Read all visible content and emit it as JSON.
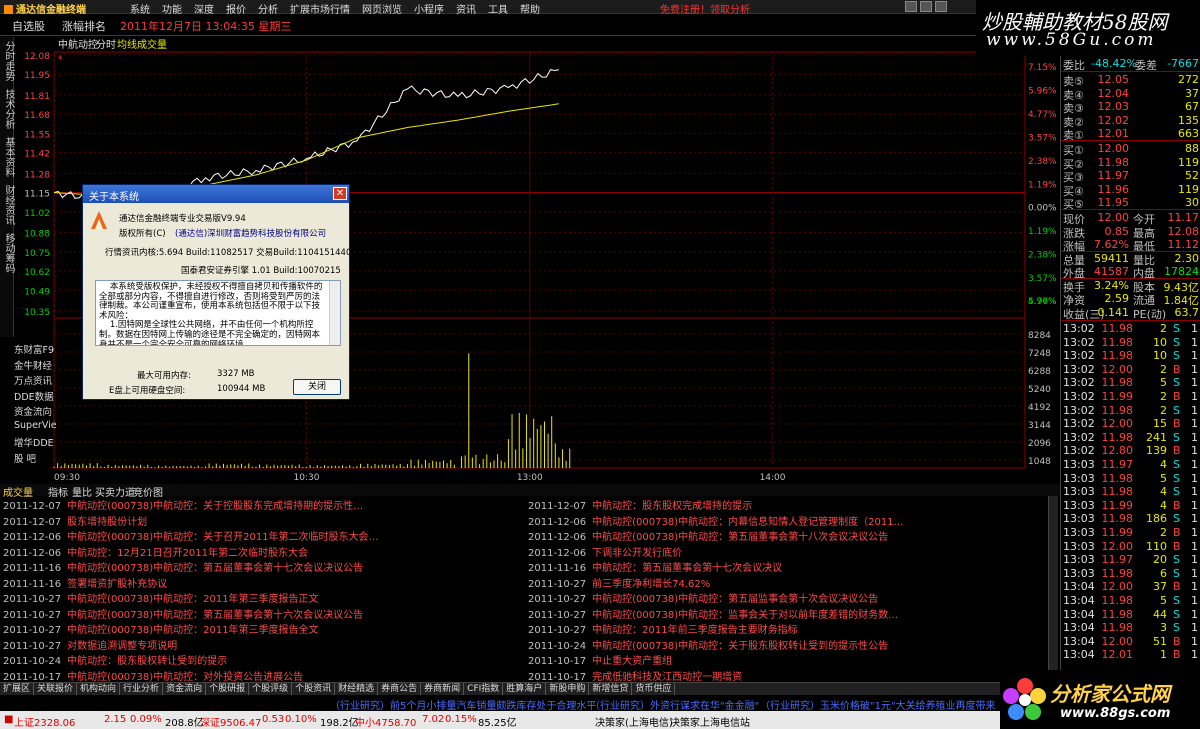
{
  "menubar": {
    "app_title": "通达信金融终端",
    "items": [
      "系统",
      "功能",
      "深度",
      "报价",
      "分析",
      "扩展市场行情",
      "网页浏览",
      "小程序",
      "资讯",
      "工具",
      "帮助"
    ],
    "alert": "免费注册！领取分析"
  },
  "watermark": {
    "line1": "炒股輔助教材58股网",
    "line2": "www.58Gu.com"
  },
  "tabs": {
    "t1": "自选股",
    "t2": "涨幅排名",
    "datetime": "2011年12月7日  13:04:35 星期三"
  },
  "leftstrip": [
    "分时走势",
    "技术分析",
    "基本资料",
    "财经资讯",
    "移动筹码"
  ],
  "chart": {
    "stock": "中航动控",
    "mode": "分时",
    "ma_label": "均线",
    "vol_label": "成交量",
    "price_ticks": [
      "12.08",
      "11.95",
      "11.81",
      "11.68",
      "11.55",
      "11.42",
      "11.28",
      "11.15",
      "11.02",
      "10.88",
      "10.75",
      "10.62",
      "10.49",
      "10.35"
    ],
    "pct_ticks": [
      "7.15%",
      "5.96%",
      "4.77%",
      "3.57%",
      "2.38%",
      "1.19%",
      "0.00%",
      "1.19%",
      "2.38%",
      "3.57%",
      "4.77%",
      "5.96%"
    ],
    "vol_ticks": [
      "8284",
      "7248",
      "6288",
      "5240",
      "4192",
      "3144",
      "2096",
      "1048"
    ],
    "time_ticks": [
      "09:30",
      "10:30",
      "13:00",
      "14:00"
    ]
  },
  "chart_data": {
    "type": "line",
    "x": [
      "09:30",
      "09:45",
      "10:00",
      "10:15",
      "10:30",
      "10:45",
      "11:00",
      "11:15",
      "11:30",
      "13:00",
      "13:04"
    ],
    "series": [
      {
        "name": "中航动控",
        "values": [
          11.15,
          11.1,
          11.12,
          11.25,
          11.3,
          11.38,
          11.5,
          11.85,
          11.8,
          11.86,
          11.98
        ]
      },
      {
        "name": "均线",
        "values": [
          11.15,
          11.13,
          11.15,
          11.2,
          11.27,
          11.37,
          11.52,
          11.59,
          11.64,
          11.7,
          11.75
        ]
      }
    ],
    "volumes": [
      300,
      200,
      150,
      280,
      220,
      180,
      260,
      520,
      7100,
      3400,
      1200
    ],
    "ylim": [
      10.35,
      12.08
    ]
  },
  "sidemenu": [
    "东财富F9",
    "金牛财经",
    "万点资讯",
    "DDE数据",
    "资金流向",
    "SuperVie",
    "增华DDE",
    "股  吧"
  ],
  "bottabs": [
    "成交量",
    "指标",
    "量比",
    "买卖力道",
    "竞价图"
  ],
  "news_left": [
    {
      "d": "2011-12-07",
      "t": "中航动控(000738)中航动控：关于控股股东完成增持期的提示性…"
    },
    {
      "d": "2011-12-07",
      "t": "股东增持股份计划"
    },
    {
      "d": "2011-12-06",
      "t": "中航动控(000738)中航动控：关于召开2011年第二次临时股东大会…"
    },
    {
      "d": "2011-12-06",
      "t": "中航动控：12月21日召开2011年第二次临时股东大会"
    },
    {
      "d": "2011-11-16",
      "t": "中航动控(000738)中航动控：第五届董事会第十七次会议决议公告"
    },
    {
      "d": "2011-11-16",
      "t": "签署增资扩股补充协议"
    },
    {
      "d": "2011-10-27",
      "t": "中航动控(000738)中航动控：2011年第三季度报告正文"
    },
    {
      "d": "2011-10-27",
      "t": "中航动控(000738)中航动控：第五届董事会第十六次会议决议公告"
    },
    {
      "d": "2011-10-27",
      "t": "中航动控(000738)中航动控：2011年第三季度报告全文"
    },
    {
      "d": "2011-10-27",
      "t": "对数据追溯调整专项说明"
    },
    {
      "d": "2011-10-24",
      "t": "中航动控：股东股权转让受到的提示"
    },
    {
      "d": "2011-10-17",
      "t": "中航动控(000738)中航动控：对外投资公告进展公告"
    }
  ],
  "news_right": [
    {
      "d": "2011-12-07",
      "t": "中航动控：股东股权完成增持的提示"
    },
    {
      "d": "2011-12-06",
      "t": "中航动控(000738)中航动控：内幕信息知情人登记管理制度（2011…"
    },
    {
      "d": "2011-12-06",
      "t": "中航动控(000738)中航动控：第五届董事会第十八次会议决议公告"
    },
    {
      "d": "2011-12-06",
      "t": "下调非公开发行底价"
    },
    {
      "d": "2011-11-16",
      "t": "中航动控：第五届董事会第十七次会议决议"
    },
    {
      "d": "2011-10-27",
      "t": "前三季度净利增长74.62%"
    },
    {
      "d": "2011-10-27",
      "t": "中航动控(000738)中航动控：第五届监事会第十次会议决议公告"
    },
    {
      "d": "2011-10-27",
      "t": "中航动控(000738)中航动控：监事会关于对以前年度差错的财务数…"
    },
    {
      "d": "2011-10-27",
      "t": "中航动控：2011年前三季度报告主要财务指标"
    },
    {
      "d": "2011-10-24",
      "t": "中航动控(000738)中航动控：关于股东股权转让受到的提示性公告"
    },
    {
      "d": "2011-10-17",
      "t": "中止重大资产重组"
    },
    {
      "d": "2011-10-17",
      "t": "完成低驰科技及江西动控一期增资"
    }
  ],
  "funcbar": [
    "扩展区",
    "关联报价",
    "机构动向",
    "行业分析",
    "资金流向",
    "个股研报",
    "个股评级",
    "个股资讯",
    "财经精选",
    "券商公告",
    "券商新闻",
    "CFI指数",
    "胜算海户",
    "新股申购",
    "新增信贷",
    "货币供应"
  ],
  "ticker1": [
    "（行业研究）前5个月小排量汽车销量颇跌库存处于合理水平",
    "（行业研究）外资行谋求在华\"金金融\"",
    "（行业研究）玉米价格破\"1元\"大关给养殖业再度带来重压"
  ],
  "ticker2": {
    "a": "上证2328.06",
    "a1": "2.15",
    "a2": "0.09%",
    "a3": "208.8亿",
    "b": "深证9506.47",
    "b1": "0.53",
    "b2": "0.10%",
    "b3": "198.2亿",
    "c": "中小4758.70",
    "c1": "7.02",
    "c2": "0.15%",
    "c3": "85.25亿",
    "d": "决策家(上海电信)",
    "e": "决策家上海电信站"
  },
  "dialog": {
    "title": "关于本系统",
    "line1": "通达信金融终端专业交易版V9.94",
    "line2a": "版权所有(C)",
    "line2b": "(通达信)深圳财富趋势科技股份有限公司",
    "line3": "行情资讯内核:5.694 Build:11082517  交易Build:1104151440",
    "line4": "国泰君安证券引擎 1.01 Build:10070215",
    "text": "    本系统受版权保护，未经授权不得擅自拷贝和传播软件的全部或部分内容，不得擅自进行修改，否则将受到严厉的法律制裁。本公司谨重宣布，使用本系统包括但不限于以下技术风险：\n    1.因特网是全球性公共网络，并不由任何一个机构所控制。数据在因特网上传输的途径是不完全确定的，因特网本身并不是一个完全安全可靠的网络环境。",
    "mem_label": "最大可用内存:",
    "mem_val": "3327 MB",
    "disk_label": "E盘上可用硬盘空间:",
    "disk_val": "100944 MB",
    "close": "关闭"
  },
  "quote": {
    "wb": "委比",
    "wb_v": "-48.42%",
    "wc": "委差",
    "wc_v": "-7667",
    "asks": [
      [
        "卖⑤",
        "12.05",
        "272"
      ],
      [
        "卖④",
        "12.04",
        "37"
      ],
      [
        "卖③",
        "12.03",
        "67"
      ],
      [
        "卖②",
        "12.02",
        "135"
      ],
      [
        "卖①",
        "12.01",
        "663"
      ]
    ],
    "bids": [
      [
        "买①",
        "12.00",
        "88"
      ],
      [
        "买②",
        "11.98",
        "119"
      ],
      [
        "买③",
        "11.97",
        "52"
      ],
      [
        "买④",
        "11.96",
        "119"
      ],
      [
        "买⑤",
        "11.95",
        "30"
      ]
    ],
    "stats": [
      [
        "现价",
        "12.00",
        "今开",
        "11.17"
      ],
      [
        "涨跌",
        "0.85",
        "最高",
        "12.08"
      ],
      [
        "涨幅",
        "7.62%",
        "最低",
        "11.12"
      ],
      [
        "总量",
        "59411",
        "量比",
        "2.30"
      ],
      [
        "外盘",
        "41587",
        "内盘",
        "17824"
      ],
      [
        "换手",
        "3.24%",
        "股本",
        "9.43亿"
      ],
      [
        "净资",
        "2.59",
        "流通",
        "1.84亿"
      ],
      [
        "收益(三)",
        "0.141",
        "PE(动)",
        "63.7"
      ]
    ],
    "ticks": [
      [
        "13:02",
        "11.98",
        "2",
        "S",
        "1"
      ],
      [
        "13:02",
        "11.98",
        "10",
        "S",
        "1"
      ],
      [
        "13:02",
        "11.98",
        "10",
        "S",
        "1"
      ],
      [
        "13:02",
        "12.00",
        "2",
        "B",
        "1"
      ],
      [
        "13:02",
        "11.98",
        "5",
        "S",
        "1"
      ],
      [
        "13:02",
        "11.99",
        "2",
        "B",
        "1"
      ],
      [
        "13:02",
        "11.98",
        "2",
        "S",
        "1"
      ],
      [
        "13:02",
        "12.00",
        "15",
        "B",
        "1"
      ],
      [
        "13:02",
        "11.98",
        "241",
        "S",
        "1"
      ],
      [
        "13:02",
        "12.80",
        "139",
        "B",
        "1"
      ],
      [
        "13:03",
        "11.97",
        "4",
        "S",
        "1"
      ],
      [
        "13:03",
        "11.98",
        "5",
        "S",
        "1"
      ],
      [
        "13:03",
        "11.98",
        "4",
        "S",
        "1"
      ],
      [
        "13:03",
        "11.99",
        "4",
        "B",
        "1"
      ],
      [
        "13:03",
        "11.98",
        "186",
        "S",
        "1"
      ],
      [
        "13:03",
        "11.99",
        "2",
        "B",
        "1"
      ],
      [
        "13:03",
        "12.00",
        "110",
        "B",
        "1"
      ],
      [
        "13:03",
        "11.97",
        "20",
        "S",
        "1"
      ],
      [
        "13:03",
        "11.98",
        "6",
        "S",
        "1"
      ],
      [
        "13:04",
        "12.00",
        "37",
        "B",
        "1"
      ],
      [
        "13:04",
        "11.98",
        "5",
        "S",
        "1"
      ],
      [
        "13:04",
        "11.98",
        "44",
        "S",
        "1"
      ],
      [
        "13:04",
        "11.98",
        "3",
        "S",
        "1"
      ],
      [
        "13:04",
        "12.00",
        "51",
        "B",
        "1"
      ],
      [
        "13:04",
        "12.01",
        "1",
        "B",
        "1"
      ]
    ]
  },
  "logo88": {
    "word": "分析家公式网",
    "url": "www.88gs.com"
  }
}
